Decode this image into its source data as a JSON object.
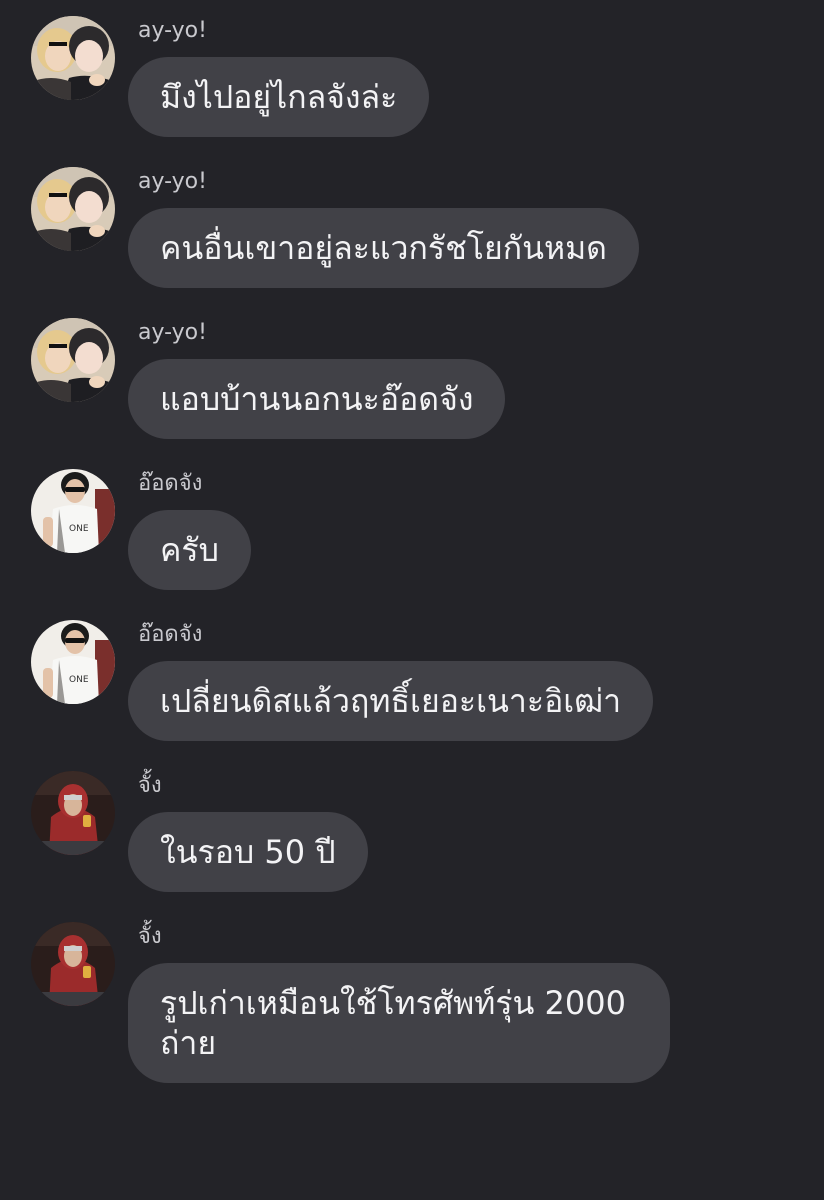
{
  "messages": [
    {
      "sender": "ay-yo!",
      "avatar": "avatar-ayyo-icon",
      "text": "มึงไปอยู่ไกลจังล่ะ"
    },
    {
      "sender": "ay-yo!",
      "avatar": "avatar-ayyo-icon",
      "text": "คนอื่นเขาอยู่ละแวกรัชโยกันหมด"
    },
    {
      "sender": "ay-yo!",
      "avatar": "avatar-ayyo-icon",
      "text": "แอบบ้านนอกนะอ๊อดจัง"
    },
    {
      "sender": "อ๊อดจัง",
      "avatar": "avatar-odjang-icon",
      "text": "ครับ"
    },
    {
      "sender": "อ๊อดจัง",
      "avatar": "avatar-odjang-icon",
      "text": "เปลี่ยนดิสแล้วฤทธิ์เยอะเนาะอิเฒ่า"
    },
    {
      "sender": "จั้ง",
      "avatar": "avatar-jang-icon",
      "text": "ในรอบ 50 ปี"
    },
    {
      "sender": "จั้ง",
      "avatar": "avatar-jang-icon",
      "text": "รูปเก่าเหมือนใช้โทรศัพท์รุ่น 2000\nถ่าย"
    }
  ],
  "colors": {
    "background": "#232328",
    "bubble": "#414147",
    "bubble_text": "#f3f3f5",
    "sender_text": "#c9c9ce"
  }
}
